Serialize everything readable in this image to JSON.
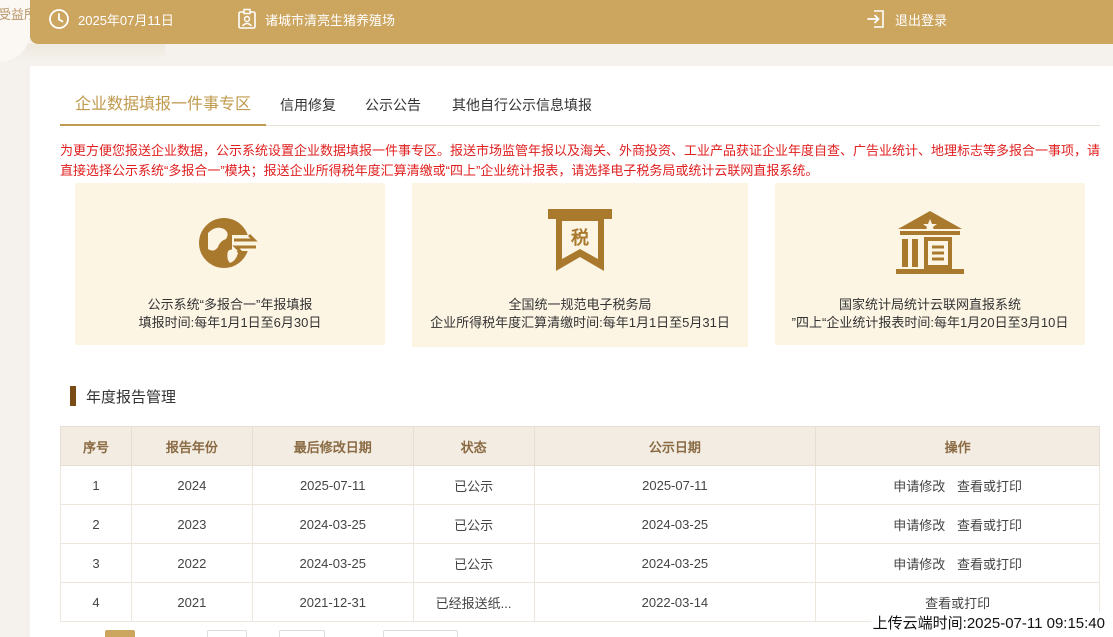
{
  "sidebar_fragment": "受益所",
  "topbar": {
    "date": "2025年07月11日",
    "farm": "诸城市清亮生猪养殖场",
    "logout": "退出登录"
  },
  "tabs": [
    {
      "label": "企业数据填报一件事专区",
      "active": true
    },
    {
      "label": "信用修复"
    },
    {
      "label": "公示公告"
    },
    {
      "label": "其他自行公示信息填报"
    }
  ],
  "notice": "为更方便您报送企业数据，公示系统设置企业数据填报一件事专区。报送市场监管年报以及海关、外商投资、工业产品获证企业年度自查、广告业统计、地理标志等多报合一事项，请直接选择公示系统“多报合一”模块；报送企业所得税年度汇算清缴或“四上”企业统计报表，请选择电子税务局或统计云联网直报系统。",
  "cards": [
    {
      "line1": "公示系统“多报合一”年报填报",
      "line2": "填报时间:每年1月1日至6月30日",
      "icon": "multi-report-icon"
    },
    {
      "line1": "全国统一规范电子税务局",
      "line2": "企业所得税年度汇算清缴时间:每年1月1日至5月31日",
      "icon": "tax-icon",
      "icon_text": "税"
    },
    {
      "line1": "国家统计局统计云联网直报系统",
      "line2": "”四上“企业统计报表时间:每年1月20日至3月10日",
      "icon": "government-building-icon"
    }
  ],
  "section_title": "年度报告管理",
  "table": {
    "headers": [
      "序号",
      "报告年份",
      "最后修改日期",
      "状态",
      "公示日期",
      "操作"
    ],
    "rows": [
      {
        "no": "1",
        "year": "2024",
        "modified": "2025-07-11",
        "status": "已公示",
        "published": "2025-07-11",
        "ops": [
          "申请修改",
          "查看或打印"
        ]
      },
      {
        "no": "2",
        "year": "2023",
        "modified": "2024-03-25",
        "status": "已公示",
        "published": "2024-03-25",
        "ops": [
          "申请修改",
          "查看或打印"
        ]
      },
      {
        "no": "3",
        "year": "2022",
        "modified": "2024-03-25",
        "status": "已公示",
        "published": "2024-03-25",
        "ops": [
          "申请修改",
          "查看或打印"
        ]
      },
      {
        "no": "4",
        "year": "2021",
        "modified": "2021-12-31",
        "status": "已经报送纸...",
        "published": "2022-03-14",
        "ops": [
          "查看或打印"
        ]
      }
    ]
  },
  "watermark": "上传云端时间:2025-07-11 09:15:40",
  "colors": {
    "gold": "#cca55e",
    "notice_red": "#e02020",
    "card_bg": "#fdf5e4",
    "icon_brown": "#a97a2e"
  }
}
